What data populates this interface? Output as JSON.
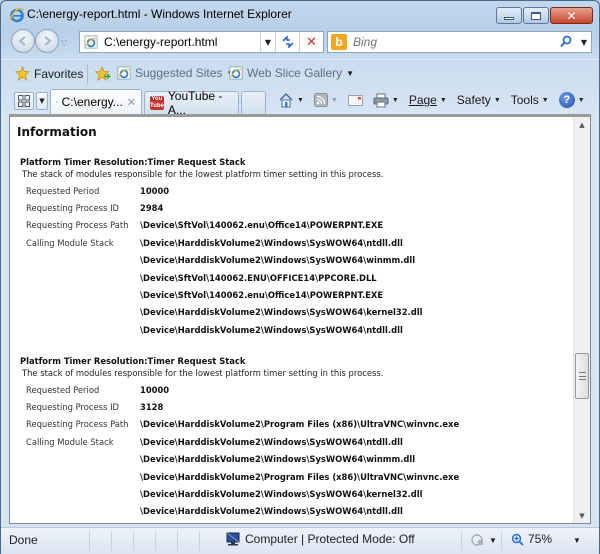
{
  "window": {
    "title": "C:\\energy-report.html - Windows Internet Explorer",
    "controls": {
      "minimize": "minimize",
      "maximize": "maximize",
      "close": "close"
    }
  },
  "navbar": {
    "address_value": "C:\\energy-report.html",
    "search_placeholder": "Bing",
    "search_provider": "b"
  },
  "favorites_bar": {
    "favorites_label": "Favorites",
    "items": [
      {
        "label": "Suggested Sites"
      },
      {
        "label": "Web Slice Gallery"
      }
    ]
  },
  "tabs": [
    {
      "label": "C:\\energy...",
      "active": true
    },
    {
      "label": "YouTube - A...",
      "active": false
    }
  ],
  "command_bar": {
    "page_label": "Page",
    "safety_label": "Safety",
    "tools_label": "Tools",
    "help_glyph": "?"
  },
  "content": {
    "heading": "Information",
    "sections": [
      {
        "title": "Platform Timer Resolution:Timer Request Stack",
        "description": "The stack of modules responsible for the lowest platform timer setting in this process.",
        "rows": [
          {
            "label": "Requested Period",
            "value": "10000"
          },
          {
            "label": "Requesting Process ID",
            "value": "2984"
          },
          {
            "label": "Requesting Process Path",
            "value": "\\Device\\SftVol\\140062.enu\\Office14\\POWERPNT.EXE"
          },
          {
            "label": "Calling Module Stack",
            "value": "\\Device\\HarddiskVolume2\\Windows\\SysWOW64\\ntdll.dll"
          },
          {
            "label": "",
            "value": "\\Device\\HarddiskVolume2\\Windows\\SysWOW64\\winmm.dll"
          },
          {
            "label": "",
            "value": "\\Device\\SftVol\\140062.ENU\\OFFICE14\\PPCORE.DLL"
          },
          {
            "label": "",
            "value": "\\Device\\SftVol\\140062.enu\\Office14\\POWERPNT.EXE"
          },
          {
            "label": "",
            "value": "\\Device\\HarddiskVolume2\\Windows\\SysWOW64\\kernel32.dll"
          },
          {
            "label": "",
            "value": "\\Device\\HarddiskVolume2\\Windows\\SysWOW64\\ntdll.dll"
          }
        ]
      },
      {
        "title": "Platform Timer Resolution:Timer Request Stack",
        "description": "The stack of modules responsible for the lowest platform timer setting in this process.",
        "rows": [
          {
            "label": "Requested Period",
            "value": "10000"
          },
          {
            "label": "Requesting Process ID",
            "value": "3128"
          },
          {
            "label": "Requesting Process Path",
            "value": "\\Device\\HarddiskVolume2\\Program Files (x86)\\UltraVNC\\winvnc.exe"
          },
          {
            "label": "Calling Module Stack",
            "value": "\\Device\\HarddiskVolume2\\Windows\\SysWOW64\\ntdll.dll"
          },
          {
            "label": "",
            "value": "\\Device\\HarddiskVolume2\\Windows\\SysWOW64\\winmm.dll"
          },
          {
            "label": "",
            "value": "\\Device\\HarddiskVolume2\\Program Files (x86)\\UltraVNC\\winvnc.exe"
          },
          {
            "label": "",
            "value": "\\Device\\HarddiskVolume2\\Windows\\SysWOW64\\kernel32.dll"
          },
          {
            "label": "",
            "value": "\\Device\\HarddiskVolume2\\Windows\\SysWOW64\\ntdll.dll"
          }
        ]
      }
    ]
  },
  "statusbar": {
    "status": "Done",
    "zone": "Computer | Protected Mode: Off",
    "zoom": "75%"
  },
  "colors": {
    "close_button": "#c6462c",
    "bing": "#f5a623",
    "youtube": "#c4302b"
  }
}
